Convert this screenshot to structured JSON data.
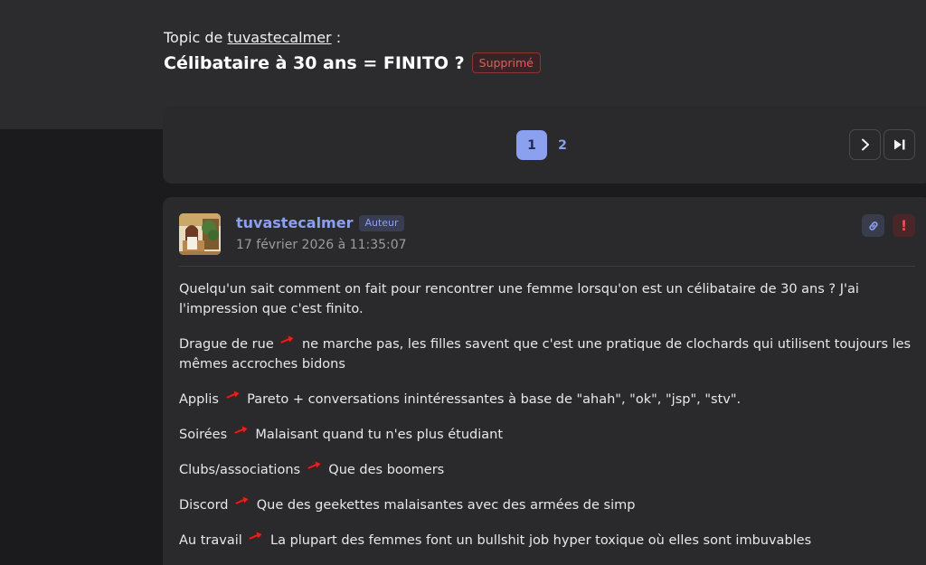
{
  "header": {
    "topic_prefix": "Topic de",
    "topic_author": "tuvastecalmer",
    "topic_suffix": " :",
    "title": "Célibataire à 30 ans = FINITO ?",
    "status_badge": "Supprimé"
  },
  "pagination": {
    "pages": [
      "1",
      "2"
    ],
    "current_page": "1",
    "next_icon": "chevron-right-icon",
    "last_icon": "skip-to-last-icon"
  },
  "post": {
    "author": "tuvastecalmer",
    "author_badge": "Auteur",
    "date": "17 février 2026 à 11:35:07",
    "actions": [
      "link-icon",
      "report-icon"
    ],
    "report_label": "!",
    "paragraphs": [
      {
        "text": "Quelqu'un sait comment on fait pour rencontrer une femme lorsqu'on est un célibataire de 30 ans ? J'ai l'impression que c'est finito."
      },
      {
        "before": "Drague de rue",
        "after": "ne marche pas, les filles savent que c'est une pratique de clochards qui utilisent toujours les mêmes accroches bidons"
      },
      {
        "before": "Applis",
        "after": "Pareto + conversations inintéressantes à base de \"ahah\", \"ok\", \"jsp\", \"stv\"."
      },
      {
        "before": "Soirées",
        "after": "Malaisant quand tu n'es plus étudiant"
      },
      {
        "before": "Clubs/associations",
        "after": "Que des boomers"
      },
      {
        "before": "Discord",
        "after": "Que des geekettes malaisantes avec des armées de simp"
      },
      {
        "before": "Au travail",
        "after": "La plupart des femmes font un bullshit job hyper toxique où elles sont imbuvables"
      }
    ]
  },
  "colors": {
    "accent": "#8ca0f0",
    "danger": "#e85b5b",
    "background": "#1b1b1d",
    "card": "#2a2a2d"
  }
}
